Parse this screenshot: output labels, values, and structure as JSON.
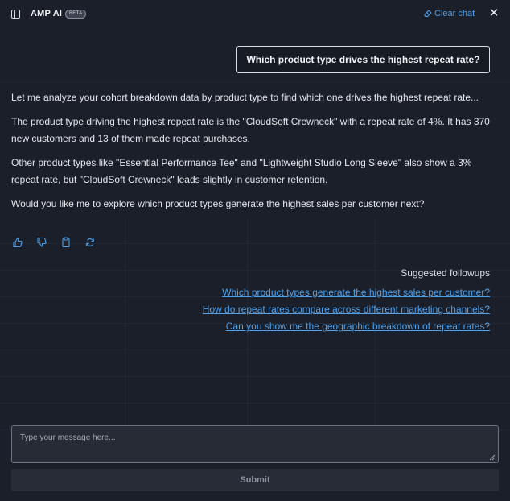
{
  "header": {
    "title": "AMP AI",
    "badge": "BETA",
    "clear_chat_label": "Clear chat",
    "close_symbol": "✕",
    "icons": [
      "sidebar-panel-icon",
      "eraser-icon",
      "close-icon"
    ]
  },
  "conversation": {
    "user_question": "Which product type drives the highest repeat rate?",
    "assistant_reply": [
      "Let me analyze your cohort breakdown data by product type to find which one drives the highest repeat rate...",
      "The product type driving the highest repeat rate is the \"CloudSoft Crewneck\" with a repeat rate of 4%. It has 370 new customers and 13 of them made repeat purchases.",
      "Other product types like \"Essential Performance Tee\" and \"Lightweight Studio Long Sleeve\" also show a 3% repeat rate, but \"CloudSoft Crewneck\" leads slightly in customer retention.",
      "Would you like me to explore which product types generate the highest sales per customer next?"
    ],
    "feedback_actions": [
      "thumbs-up-icon",
      "thumbs-down-icon",
      "copy-icon",
      "regenerate-icon"
    ]
  },
  "followups": {
    "heading": "Suggested followups",
    "items": [
      "Which product types generate the highest sales per customer?",
      "How do repeat rates compare across different marketing channels?",
      "Can you show me the geographic breakdown of repeat rates?"
    ]
  },
  "composer": {
    "placeholder": "Type your message here...",
    "value": "",
    "submit_label": "Submit"
  },
  "colors": {
    "background": "#1a1f29",
    "accent_link": "#4ea1ea",
    "text": "#e4e7ec"
  }
}
